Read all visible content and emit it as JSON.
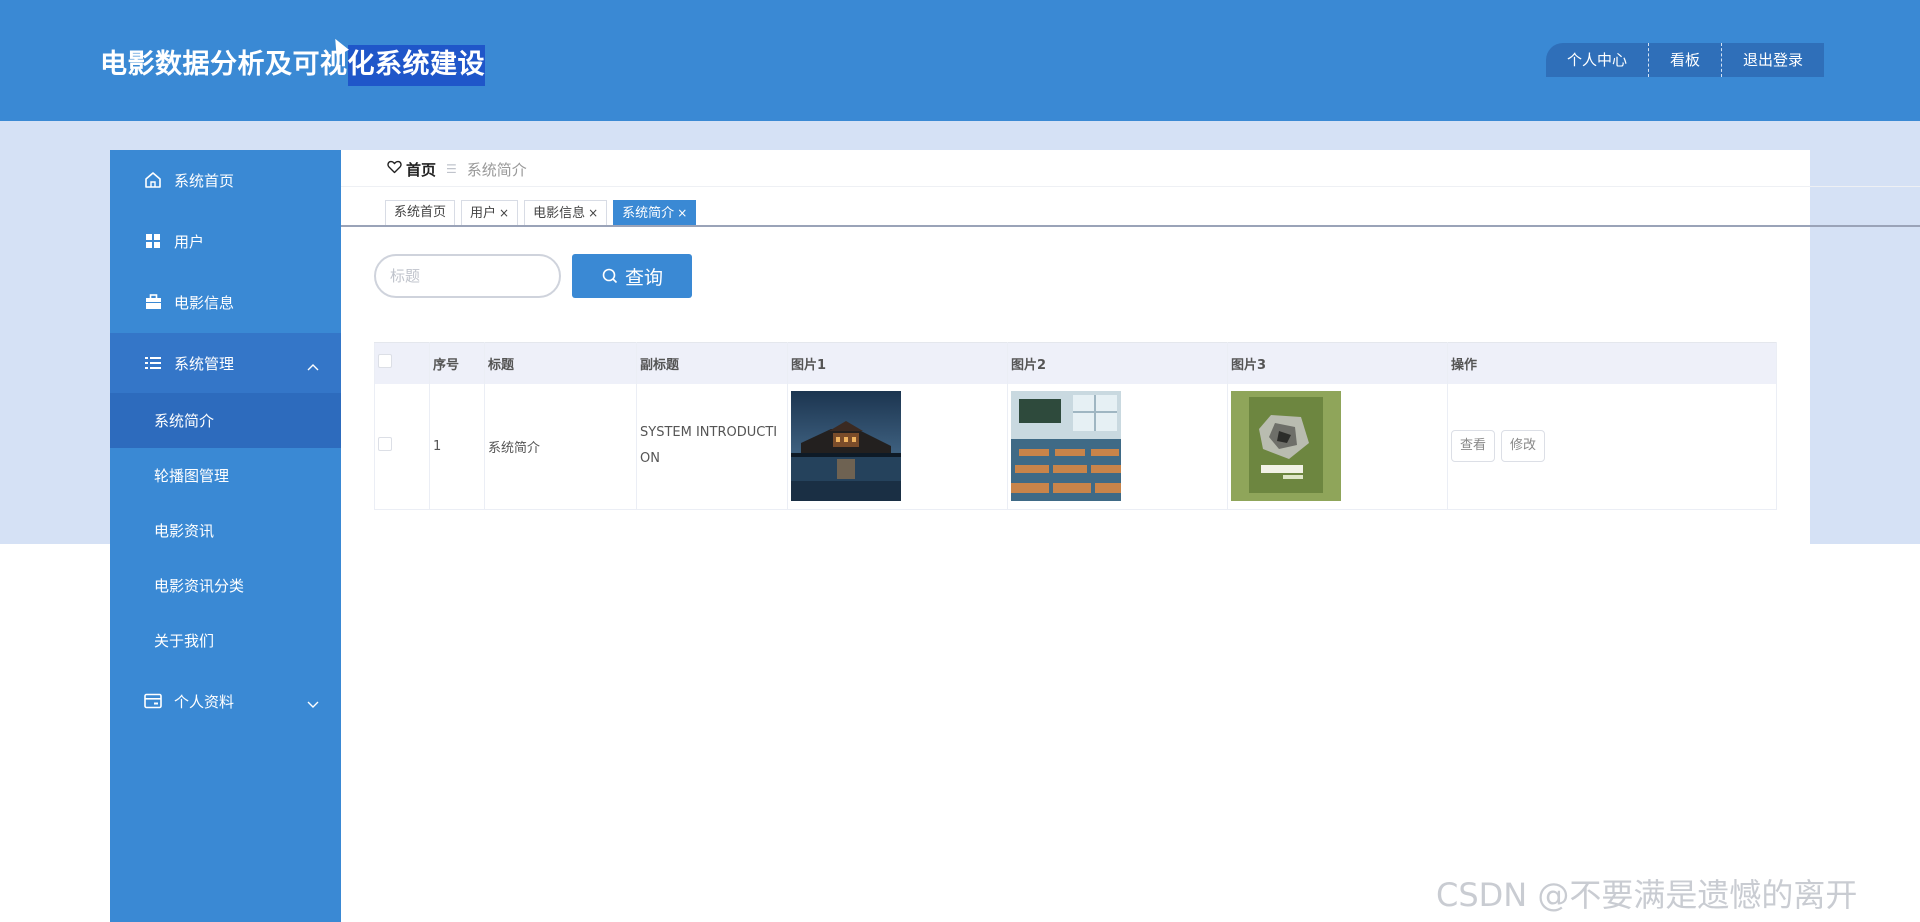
{
  "header": {
    "title_normal": "电影数据分析及可视",
    "title_selected": "化系统建设",
    "nav": [
      "个人中心",
      "看板",
      "退出登录"
    ]
  },
  "sidebar": {
    "items": [
      {
        "label": "系统首页",
        "icon": "home-icon"
      },
      {
        "label": "用户",
        "icon": "grid-icon"
      },
      {
        "label": "电影信息",
        "icon": "briefcase-icon"
      },
      {
        "label": "系统管理",
        "icon": "list-icon",
        "expanded": true
      },
      {
        "label": "个人资料",
        "icon": "card-icon",
        "expanded": false
      }
    ],
    "sub_items": [
      "系统简介",
      "轮播图管理",
      "电影资讯",
      "电影资讯分类",
      "关于我们"
    ],
    "active_sub": "系统简介"
  },
  "breadcrumb": {
    "home": "首页",
    "separator": "☰",
    "current": "系统简介"
  },
  "tabs": [
    {
      "label": "系统首页",
      "closable": false,
      "active": false
    },
    {
      "label": "用户",
      "closable": true,
      "active": false
    },
    {
      "label": "电影信息",
      "closable": true,
      "active": false
    },
    {
      "label": "系统简介",
      "closable": true,
      "active": true
    }
  ],
  "tab_close_glyph": "×",
  "search": {
    "placeholder": "标题",
    "button_label": "查询"
  },
  "table": {
    "columns": [
      "",
      "序号",
      "标题",
      "副标题",
      "图片1",
      "图片2",
      "图片3",
      "操作"
    ],
    "rows": [
      {
        "index": "1",
        "title": "系统简介",
        "subtitle": "SYSTEM INTRODUCTION",
        "images": [
          "night-palace-photo",
          "classroom-photo",
          "green-book-cover"
        ],
        "actions": [
          "查看",
          "修改"
        ]
      }
    ]
  },
  "watermark": "CSDN @不要满是遗憾的离开",
  "colors": {
    "primary": "#3a89d4",
    "sidebar_active": "#2d6bbd",
    "band": "#d5e1f5"
  }
}
